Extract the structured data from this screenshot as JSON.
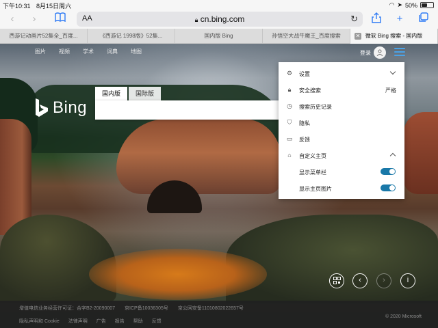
{
  "status": {
    "time": "下午10:31",
    "date": "8月15日周六",
    "battery": "50%",
    "battery_level": 0.5
  },
  "browser": {
    "aa": "AA",
    "url": "cn.bing.com",
    "tabs": [
      {
        "label": "西游记动画片52集全_百度..."
      },
      {
        "label": "《西游记 1998版》52集..."
      },
      {
        "label": "国内版 Bing"
      },
      {
        "label": "孙悟空大战牛魔王_百度搜索"
      },
      {
        "label": "微软 Bing 搜索 - 国内版"
      }
    ]
  },
  "nav": {
    "items": [
      "图片",
      "视频",
      "学术",
      "词典",
      "地图"
    ]
  },
  "account": {
    "signin": "登录"
  },
  "logo": {
    "text": "Bing"
  },
  "search": {
    "tabs": [
      "国内版",
      "国际版"
    ],
    "value": ""
  },
  "menu": {
    "settings": "设置",
    "safe_search": "安全搜索",
    "safe_search_value": "严格",
    "history": "搜索历史记录",
    "privacy": "隐私",
    "feedback": "反馈",
    "customize": "自定义主页",
    "show_menu_bar": "显示菜单栏",
    "show_homepage_image": "显示主页图片"
  },
  "footer": {
    "row1": [
      "增值电信业务经营许可证：合字B2-20090007",
      "京ICP备10036305号",
      "京公网安备11010802022657号"
    ],
    "row2": [
      "隐私声明和 Cookie",
      "法律声明",
      "广告",
      "报告",
      "帮助",
      "反馈"
    ],
    "copyright": "© 2020 Microsoft"
  },
  "colors": {
    "accent": "#2f7bf5",
    "toggle_on": "#1978a8",
    "hamburger": "#4aa3e8"
  }
}
